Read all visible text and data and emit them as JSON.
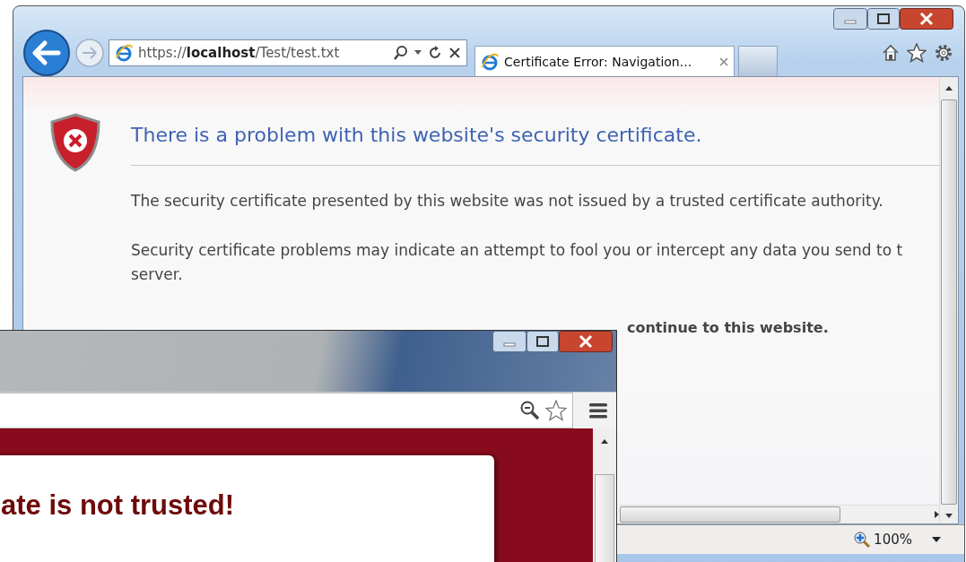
{
  "ie_window": {
    "address": {
      "scheme": "https://",
      "host": "localhost",
      "path": "/Test/test.txt"
    },
    "tabs": [
      {
        "label": "Certificate Error: Navigation...",
        "selected": true
      }
    ],
    "heading": "There is a problem with this website's security certificate.",
    "paragraphs": [
      {
        "kind": "normal",
        "lines": [
          "The security certificate presented by this website was not issued by a trusted certificate authority."
        ]
      },
      {
        "kind": "normal",
        "lines": [
          "Security certificate problems may indicate an attempt to fool you or intercept any data you send to t",
          "server."
        ]
      },
      {
        "kind": "bold",
        "lines": [
          "continue to this website."
        ]
      }
    ],
    "zoom": "100%"
  },
  "chrome_window": {
    "heading": "ate is not trusted!"
  }
}
